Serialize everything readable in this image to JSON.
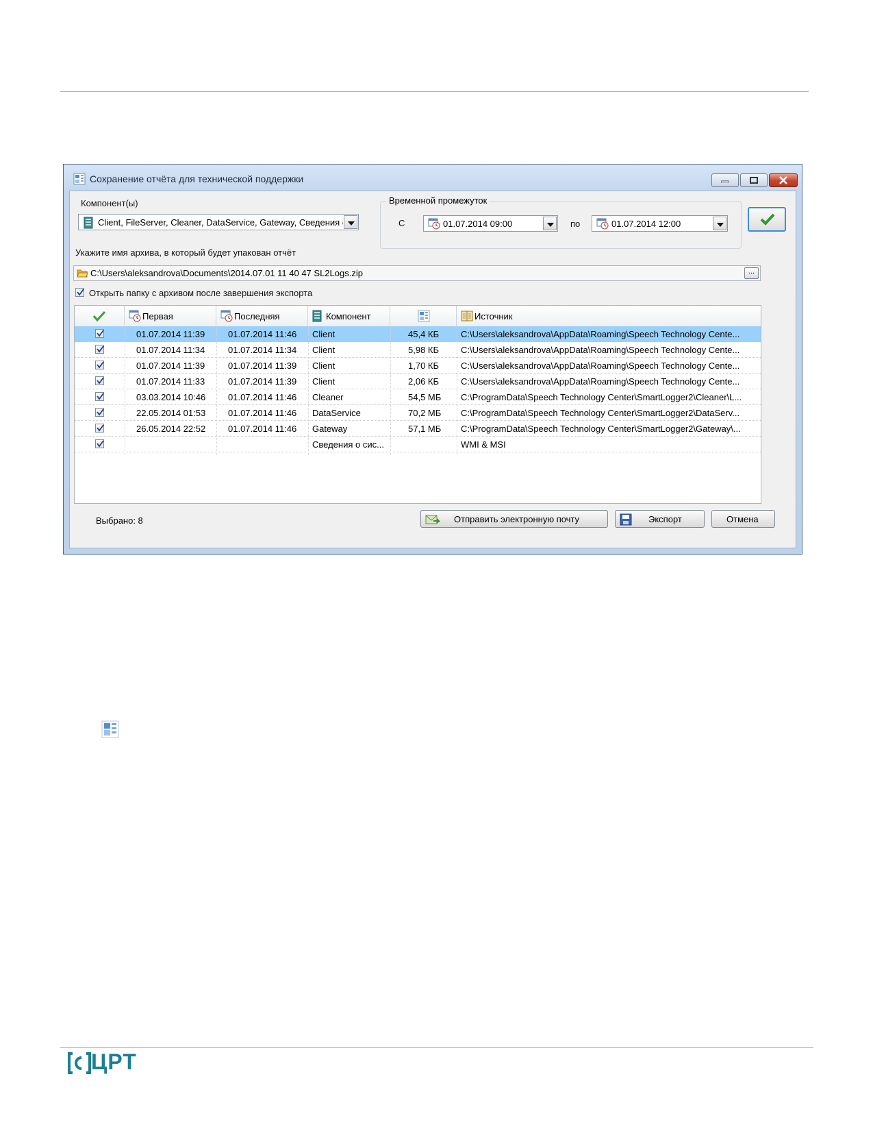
{
  "window": {
    "title": "Сохранение отчёта для технической поддержки"
  },
  "components": {
    "label": "Компонент(ы)",
    "value": "Client, FileServer, Cleaner, DataService, Gateway, Сведения о системе"
  },
  "time_range": {
    "label": "Временной промежуток",
    "from_label": "С",
    "from_value": "01.07.2014 09:00",
    "to_label": "по",
    "to_value": "01.07.2014 12:00"
  },
  "archive": {
    "label": "Укажите имя архива, в который будет упакован отчёт",
    "path": "C:\\Users\\aleksandrova\\Documents\\2014.07.01 11 40 47 SL2Logs.zip",
    "browse_label": "..."
  },
  "open_folder": {
    "checked": true,
    "label": "Открыть папку с архивом после завершения экспорта"
  },
  "grid": {
    "columns": [
      "",
      "Первая",
      "Последняя",
      "Компонент",
      "",
      "Источник"
    ],
    "rows": [
      {
        "checked": true,
        "first": "01.07.2014 11:39",
        "last": "01.07.2014 11:46",
        "component": "Client",
        "size": "45,4 КБ",
        "source": "C:\\Users\\aleksandrova\\AppData\\Roaming\\Speech  Technology  Cente...",
        "selected": true
      },
      {
        "checked": true,
        "first": "01.07.2014 11:34",
        "last": "01.07.2014 11:34",
        "component": "Client",
        "size": "5,98 КБ",
        "source": "C:\\Users\\aleksandrova\\AppData\\Roaming\\Speech  Technology  Cente...",
        "selected": false
      },
      {
        "checked": true,
        "first": "01.07.2014 11:39",
        "last": "01.07.2014 11:39",
        "component": "Client",
        "size": "1,70 КБ",
        "source": "C:\\Users\\aleksandrova\\AppData\\Roaming\\Speech  Technology  Cente...",
        "selected": false
      },
      {
        "checked": true,
        "first": "01.07.2014 11:33",
        "last": "01.07.2014 11:39",
        "component": "Client",
        "size": "2,06 КБ",
        "source": "C:\\Users\\aleksandrova\\AppData\\Roaming\\Speech  Technology  Cente...",
        "selected": false
      },
      {
        "checked": true,
        "first": "03.03.2014 10:46",
        "last": "01.07.2014 11:46",
        "component": "Cleaner",
        "size": "54,5 МБ",
        "source": "C:\\ProgramData\\Speech  Technology  Center\\SmartLogger2\\Cleaner\\L...",
        "selected": false
      },
      {
        "checked": true,
        "first": "22.05.2014 01:53",
        "last": "01.07.2014 11:46",
        "component": "DataService",
        "size": "70,2 МБ",
        "source": "C:\\ProgramData\\Speech  Technology  Center\\SmartLogger2\\DataServ...",
        "selected": false
      },
      {
        "checked": true,
        "first": "26.05.2014 22:52",
        "last": "01.07.2014 11:46",
        "component": "Gateway",
        "size": "57,1 МБ",
        "source": "C:\\ProgramData\\Speech  Technology  Center\\SmartLogger2\\Gateway\\...",
        "selected": false
      },
      {
        "checked": true,
        "first": "",
        "last": "",
        "component": "Сведения  о  сис...",
        "size": "",
        "source": "WMI & MSI",
        "selected": false
      }
    ]
  },
  "status": {
    "label": "Выбрано:  8"
  },
  "buttons": {
    "email": "Отправить электронную почту",
    "export": "Экспорт",
    "cancel": "Отмена"
  },
  "footer": {
    "logo_text": "ЦРТ"
  },
  "colors": {
    "selected_row": "#99d1fb",
    "accent_line": "#8fc3cc",
    "logo": "#1c7f92"
  }
}
